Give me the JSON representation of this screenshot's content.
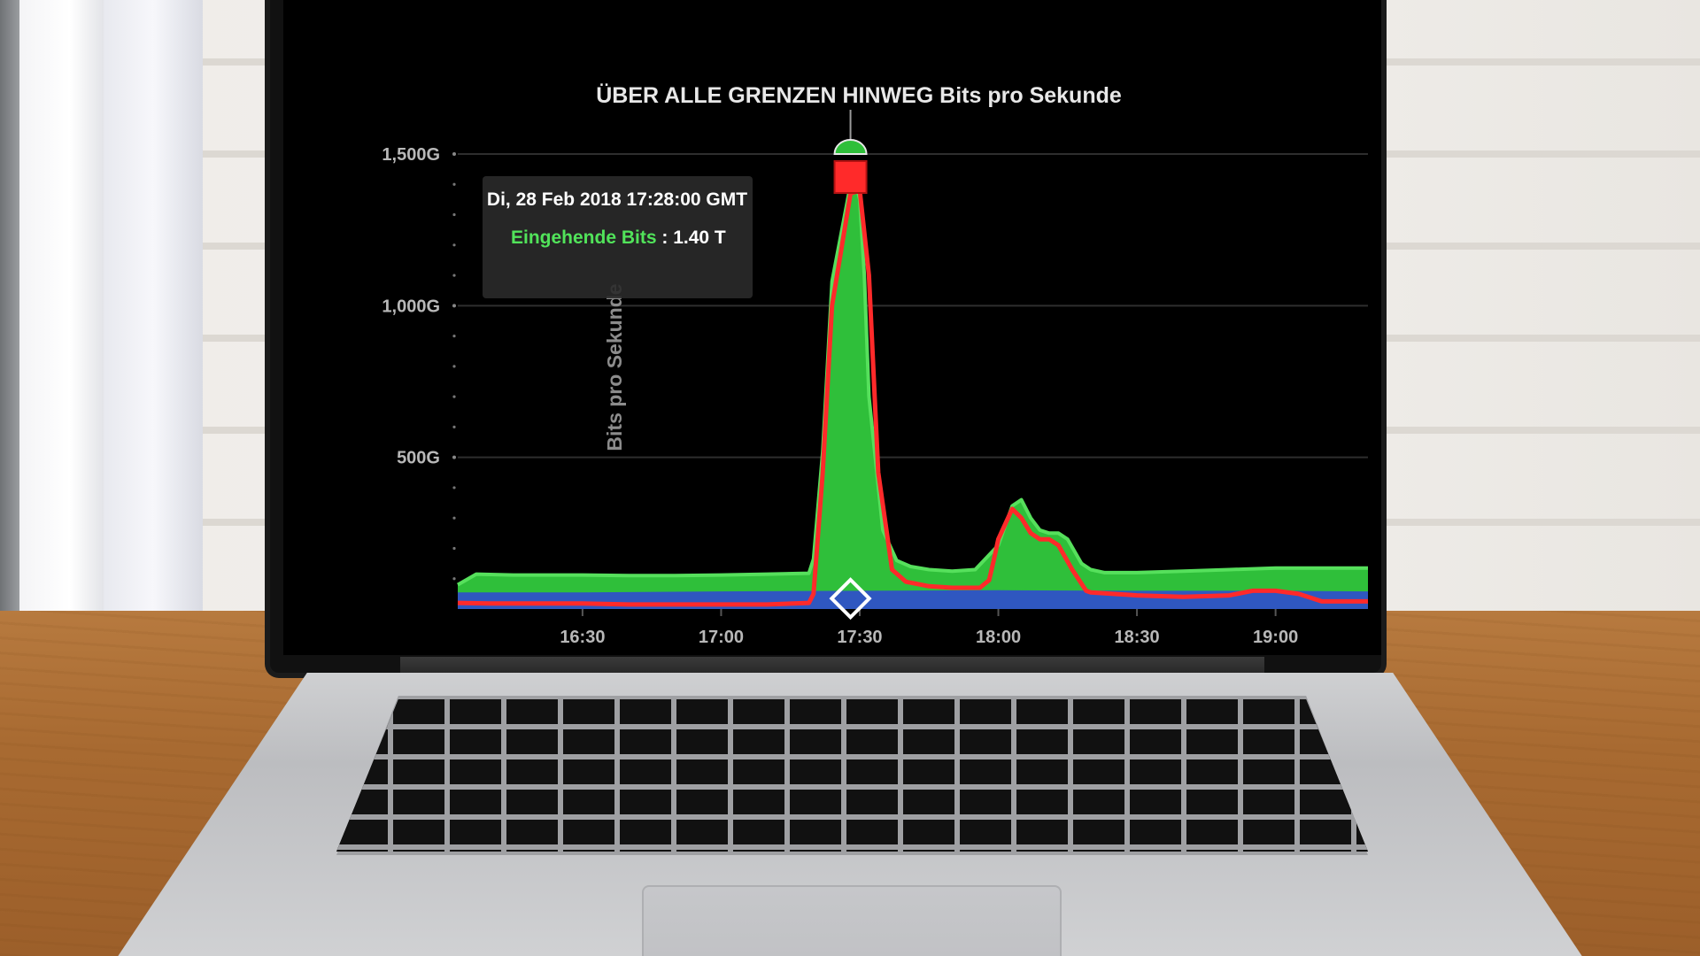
{
  "chart_data": {
    "type": "area",
    "title": "ÜBER ALLE GRENZEN HINWEG Bits pro Sekunde",
    "xlabel": "",
    "ylabel": "Bits pro Sekunde",
    "grid": true,
    "yticks": [
      "500G",
      "1,000G",
      "1,500G"
    ],
    "ytick_values": [
      500,
      1000,
      1500
    ],
    "ylim": [
      0,
      1500
    ],
    "ylim_unit": "Gbit/s",
    "xticks": [
      "16:30",
      "17:00",
      "17:30",
      "18:00",
      "18:30",
      "19:00"
    ],
    "xtick_values": [
      990,
      1020,
      1050,
      1080,
      1110,
      1140
    ],
    "xlim": [
      963,
      1160
    ],
    "x_unit": "minutes of day",
    "series": [
      {
        "name": "Eingehende Bits",
        "color": "#2fbf3a",
        "x": [
          963,
          967,
          975,
          990,
          1000,
          1010,
          1020,
          1030,
          1039,
          1040,
          1042,
          1044,
          1048,
          1049,
          1050,
          1051,
          1052,
          1055,
          1058,
          1061,
          1065,
          1070,
          1075,
          1080,
          1083,
          1085,
          1087,
          1089,
          1091,
          1093,
          1095,
          1098,
          1100,
          1103,
          1110,
          1120,
          1130,
          1140,
          1150,
          1160
        ],
        "values": [
          80,
          115,
          112,
          112,
          110,
          110,
          112,
          115,
          118,
          165,
          520,
          1080,
          1400,
          1420,
          1350,
          1100,
          700,
          260,
          160,
          140,
          130,
          125,
          130,
          210,
          340,
          360,
          300,
          260,
          250,
          250,
          230,
          150,
          130,
          120,
          120,
          125,
          130,
          135,
          135,
          135
        ]
      },
      {
        "name": "",
        "color": "#2f57c0",
        "x": [
          963,
          990,
          1020,
          1050,
          1080,
          1110,
          1140,
          1160
        ],
        "values": [
          55,
          55,
          58,
          60,
          62,
          60,
          60,
          58
        ]
      },
      {
        "name": "",
        "color": "#ff2a2a",
        "x": [
          963,
          970,
          990,
          1000,
          1020,
          1030,
          1039,
          1040,
          1042,
          1044,
          1048,
          1050,
          1052,
          1054,
          1057,
          1060,
          1065,
          1070,
          1076,
          1078,
          1079,
          1080,
          1083,
          1085,
          1087,
          1089,
          1091,
          1093,
          1096,
          1099,
          1100,
          1110,
          1120,
          1130,
          1135,
          1140,
          1145,
          1150,
          1160
        ],
        "values": [
          20,
          18,
          18,
          15,
          15,
          15,
          20,
          50,
          450,
          1000,
          1370,
          1380,
          1100,
          450,
          130,
          90,
          75,
          70,
          70,
          95,
          160,
          230,
          330,
          300,
          250,
          230,
          230,
          210,
          130,
          60,
          55,
          45,
          40,
          45,
          60,
          60,
          50,
          25,
          25
        ]
      }
    ],
    "tooltip": {
      "date": "Di, 28 Feb 2018 17:28:00 GMT",
      "series_name": "Eingehende Bits",
      "separator": " : ",
      "value": "1.40 T",
      "series_color": "#51e35a"
    },
    "highlight_x": 1048,
    "peak_marker_value": 1500
  }
}
